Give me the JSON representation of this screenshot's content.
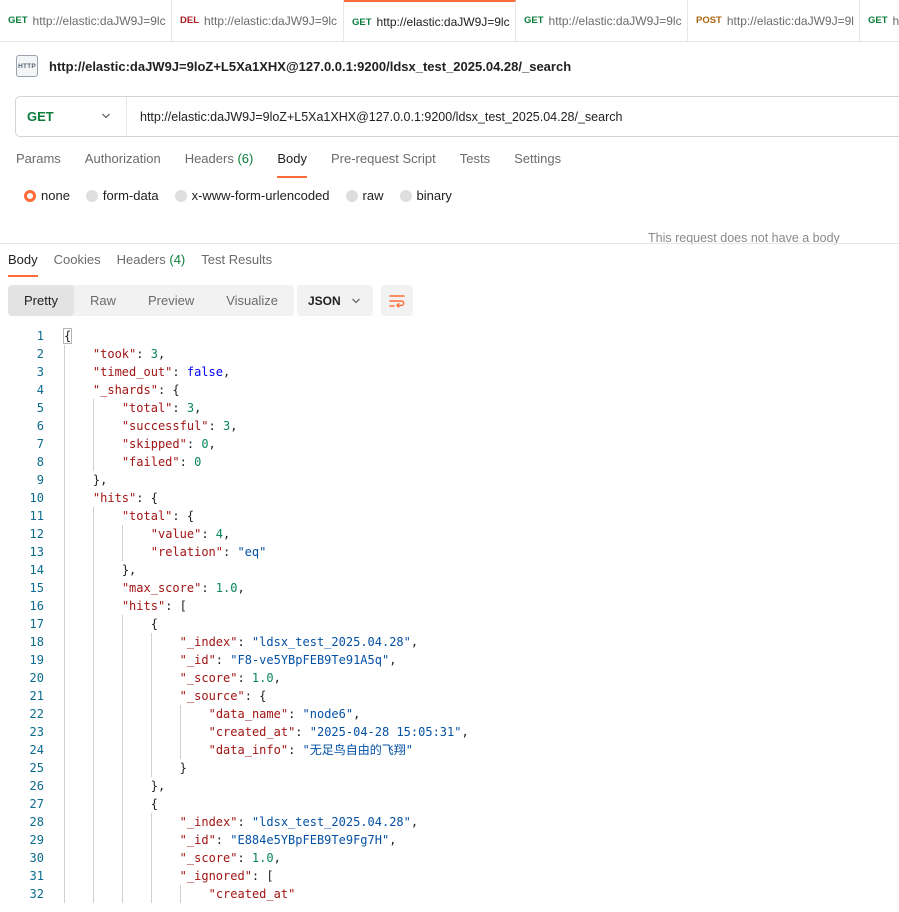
{
  "tabs": [
    {
      "method": "GET",
      "url": "http://elastic:daJW9J=9lc"
    },
    {
      "method": "DEL",
      "url": "http://elastic:daJW9J=9lc"
    },
    {
      "method": "GET",
      "url": "http://elastic:daJW9J=9lc",
      "active": true
    },
    {
      "method": "GET",
      "url": "http://elastic:daJW9J=9lc"
    },
    {
      "method": "POST",
      "url": "http://elastic:daJW9J=9l"
    },
    {
      "method": "GET",
      "url": "ht"
    }
  ],
  "request": {
    "icon_label": "HTTP",
    "title": "http://elastic:daJW9J=9loZ+L5Xa1XHX@127.0.0.1:9200/ldsx_test_2025.04.28/_search",
    "method": "GET",
    "url": "http://elastic:daJW9J=9loZ+L5Xa1XHX@127.0.0.1:9200/ldsx_test_2025.04.28/_search"
  },
  "request_tabs": {
    "params": "Params",
    "authorization": "Authorization",
    "headers": "Headers",
    "headers_count": "(6)",
    "body": "Body",
    "prerequest": "Pre-request Script",
    "tests": "Tests",
    "settings": "Settings"
  },
  "body_types": [
    "none",
    "form-data",
    "x-www-form-urlencoded",
    "raw",
    "binary"
  ],
  "no_body_message": "This request does not have a body",
  "response_tabs": {
    "body": "Body",
    "cookies": "Cookies",
    "headers": "Headers",
    "headers_count": "(4)",
    "test_results": "Test Results"
  },
  "view_modes": [
    "Pretty",
    "Raw",
    "Preview",
    "Visualize"
  ],
  "format": "JSON",
  "icons": {
    "http": "http-file-icon",
    "method_dropdown": "chevron-down-icon",
    "format_dropdown": "chevron-down-icon",
    "wrap": "wrap-lines-icon"
  },
  "colors": {
    "accent": "#ff6c37",
    "get": "#0a7d3b",
    "delete": "#a61e22",
    "post": "#a9650b",
    "json_key": "#a31515",
    "json_string": "#0451a5",
    "json_number": "#098658",
    "json_boolean": "#0000ff",
    "line_number": "#0b6b8f"
  },
  "code_lines": [
    {
      "num": 1,
      "indent": 0,
      "parts": [
        [
          "p",
          "{"
        ]
      ]
    },
    {
      "num": 2,
      "indent": 1,
      "parts": [
        [
          "k",
          "\"took\""
        ],
        [
          "p",
          ": "
        ],
        [
          "n",
          "3"
        ],
        [
          "p",
          ","
        ]
      ]
    },
    {
      "num": 3,
      "indent": 1,
      "parts": [
        [
          "k",
          "\"timed_out\""
        ],
        [
          "p",
          ": "
        ],
        [
          "b",
          "false"
        ],
        [
          "p",
          ","
        ]
      ]
    },
    {
      "num": 4,
      "indent": 1,
      "parts": [
        [
          "k",
          "\"_shards\""
        ],
        [
          "p",
          ": {"
        ]
      ]
    },
    {
      "num": 5,
      "indent": 2,
      "parts": [
        [
          "k",
          "\"total\""
        ],
        [
          "p",
          ": "
        ],
        [
          "n",
          "3"
        ],
        [
          "p",
          ","
        ]
      ]
    },
    {
      "num": 6,
      "indent": 2,
      "parts": [
        [
          "k",
          "\"successful\""
        ],
        [
          "p",
          ": "
        ],
        [
          "n",
          "3"
        ],
        [
          "p",
          ","
        ]
      ]
    },
    {
      "num": 7,
      "indent": 2,
      "parts": [
        [
          "k",
          "\"skipped\""
        ],
        [
          "p",
          ": "
        ],
        [
          "n",
          "0"
        ],
        [
          "p",
          ","
        ]
      ]
    },
    {
      "num": 8,
      "indent": 2,
      "parts": [
        [
          "k",
          "\"failed\""
        ],
        [
          "p",
          ": "
        ],
        [
          "n",
          "0"
        ]
      ]
    },
    {
      "num": 9,
      "indent": 1,
      "parts": [
        [
          "p",
          "},"
        ]
      ]
    },
    {
      "num": 10,
      "indent": 1,
      "parts": [
        [
          "k",
          "\"hits\""
        ],
        [
          "p",
          ": {"
        ]
      ]
    },
    {
      "num": 11,
      "indent": 2,
      "parts": [
        [
          "k",
          "\"total\""
        ],
        [
          "p",
          ": {"
        ]
      ]
    },
    {
      "num": 12,
      "indent": 3,
      "parts": [
        [
          "k",
          "\"value\""
        ],
        [
          "p",
          ": "
        ],
        [
          "n",
          "4"
        ],
        [
          "p",
          ","
        ]
      ]
    },
    {
      "num": 13,
      "indent": 3,
      "parts": [
        [
          "k",
          "\"relation\""
        ],
        [
          "p",
          ": "
        ],
        [
          "s",
          "\"eq\""
        ]
      ]
    },
    {
      "num": 14,
      "indent": 2,
      "parts": [
        [
          "p",
          "},"
        ]
      ]
    },
    {
      "num": 15,
      "indent": 2,
      "parts": [
        [
          "k",
          "\"max_score\""
        ],
        [
          "p",
          ": "
        ],
        [
          "n",
          "1.0"
        ],
        [
          "p",
          ","
        ]
      ]
    },
    {
      "num": 16,
      "indent": 2,
      "parts": [
        [
          "k",
          "\"hits\""
        ],
        [
          "p",
          ": ["
        ]
      ]
    },
    {
      "num": 17,
      "indent": 3,
      "parts": [
        [
          "p",
          "{"
        ]
      ]
    },
    {
      "num": 18,
      "indent": 4,
      "parts": [
        [
          "k",
          "\"_index\""
        ],
        [
          "p",
          ": "
        ],
        [
          "s",
          "\"ldsx_test_2025.04.28\""
        ],
        [
          "p",
          ","
        ]
      ]
    },
    {
      "num": 19,
      "indent": 4,
      "parts": [
        [
          "k",
          "\"_id\""
        ],
        [
          "p",
          ": "
        ],
        [
          "s",
          "\"F8-ve5YBpFEB9Te91A5q\""
        ],
        [
          "p",
          ","
        ]
      ]
    },
    {
      "num": 20,
      "indent": 4,
      "parts": [
        [
          "k",
          "\"_score\""
        ],
        [
          "p",
          ": "
        ],
        [
          "n",
          "1.0"
        ],
        [
          "p",
          ","
        ]
      ]
    },
    {
      "num": 21,
      "indent": 4,
      "parts": [
        [
          "k",
          "\"_source\""
        ],
        [
          "p",
          ": {"
        ]
      ]
    },
    {
      "num": 22,
      "indent": 5,
      "parts": [
        [
          "k",
          "\"data_name\""
        ],
        [
          "p",
          ": "
        ],
        [
          "s",
          "\"node6\""
        ],
        [
          "p",
          ","
        ]
      ]
    },
    {
      "num": 23,
      "indent": 5,
      "parts": [
        [
          "k",
          "\"created_at\""
        ],
        [
          "p",
          ": "
        ],
        [
          "s",
          "\"2025-04-28 15:05:31\""
        ],
        [
          "p",
          ","
        ]
      ]
    },
    {
      "num": 24,
      "indent": 5,
      "parts": [
        [
          "k",
          "\"data_info\""
        ],
        [
          "p",
          ": "
        ],
        [
          "s",
          "\"无足鸟自由的飞翔\""
        ]
      ]
    },
    {
      "num": 25,
      "indent": 4,
      "parts": [
        [
          "p",
          "}"
        ]
      ]
    },
    {
      "num": 26,
      "indent": 3,
      "parts": [
        [
          "p",
          "},"
        ]
      ]
    },
    {
      "num": 27,
      "indent": 3,
      "parts": [
        [
          "p",
          "{"
        ]
      ]
    },
    {
      "num": 28,
      "indent": 4,
      "parts": [
        [
          "k",
          "\"_index\""
        ],
        [
          "p",
          ": "
        ],
        [
          "s",
          "\"ldsx_test_2025.04.28\""
        ],
        [
          "p",
          ","
        ]
      ]
    },
    {
      "num": 29,
      "indent": 4,
      "parts": [
        [
          "k",
          "\"_id\""
        ],
        [
          "p",
          ": "
        ],
        [
          "s",
          "\"E884e5YBpFEB9Te9Fg7H\""
        ],
        [
          "p",
          ","
        ]
      ]
    },
    {
      "num": 30,
      "indent": 4,
      "parts": [
        [
          "k",
          "\"_score\""
        ],
        [
          "p",
          ": "
        ],
        [
          "n",
          "1.0"
        ],
        [
          "p",
          ","
        ]
      ]
    },
    {
      "num": 31,
      "indent": 4,
      "parts": [
        [
          "k",
          "\"_ignored\""
        ],
        [
          "p",
          ": ["
        ]
      ]
    },
    {
      "num": 32,
      "indent": 5,
      "parts": [
        [
          "k",
          "\"created_at\""
        ]
      ]
    }
  ]
}
